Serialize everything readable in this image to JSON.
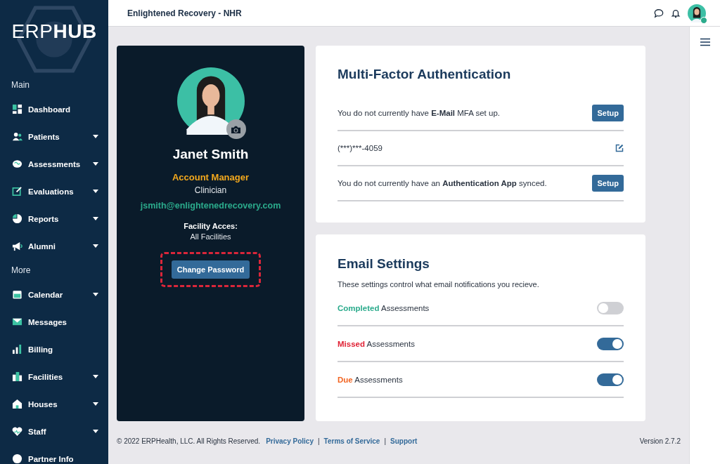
{
  "brand": {
    "light": "ERP",
    "bold": "HUB"
  },
  "sidebar": {
    "sections": [
      {
        "heading": "Main",
        "items": [
          {
            "label": "Dashboard",
            "expandable": false
          },
          {
            "label": "Patients",
            "expandable": true
          },
          {
            "label": "Assessments",
            "expandable": true
          },
          {
            "label": "Evaluations",
            "expandable": true
          },
          {
            "label": "Reports",
            "expandable": true
          },
          {
            "label": "Alumni",
            "expandable": true
          }
        ]
      },
      {
        "heading": "More",
        "items": [
          {
            "label": "Calendar",
            "expandable": true
          },
          {
            "label": "Messages",
            "expandable": false
          },
          {
            "label": "Billing",
            "expandable": false
          },
          {
            "label": "Facilities",
            "expandable": true
          },
          {
            "label": "Houses",
            "expandable": true
          },
          {
            "label": "Staff",
            "expandable": true
          },
          {
            "label": "Partner Info",
            "expandable": false
          }
        ]
      }
    ]
  },
  "header": {
    "title": "Enlightened Recovery - NHR",
    "user_online": true
  },
  "profile": {
    "name": "Janet Smith",
    "role": "Account Manager",
    "title": "Clinician",
    "email": "jsmith@enlightenedrecovery.com",
    "facility_label": "Facility Acces:",
    "facility_value": "All Facilities",
    "button": "Change Password",
    "button_highlighted": true
  },
  "mfa": {
    "title": "Multi-Factor Authentication",
    "rows": [
      {
        "kind": "setup",
        "text": "You do not currently have **E-Mail** MFA set up.",
        "button": "Setup"
      },
      {
        "kind": "edit",
        "text": "(***)***-4059"
      },
      {
        "kind": "setup",
        "text": "You do not currently have an **Authentication App** synced.",
        "button": "Setup"
      }
    ]
  },
  "email_settings": {
    "title": "Email Settings",
    "description": "These settings control what email notifications you recieve.",
    "rows": [
      {
        "highlight": "Completed",
        "color": "#2bab8c",
        "label": "Assessments",
        "on": false
      },
      {
        "highlight": "Missed",
        "color": "#e02235",
        "label": "Assessments",
        "on": true
      },
      {
        "highlight": "Due",
        "color": "#f26522",
        "label": "Assessments",
        "on": true
      }
    ]
  },
  "footer": {
    "copyright": "© 2022 ERPHealth, LLC. All Rights Reserved.",
    "links": [
      {
        "label": "Privacy Policy",
        "separator": "|"
      },
      {
        "label": "Terms of Service",
        "separator": "|"
      },
      {
        "label": "Support"
      }
    ],
    "version": "Version 2.7.2"
  }
}
